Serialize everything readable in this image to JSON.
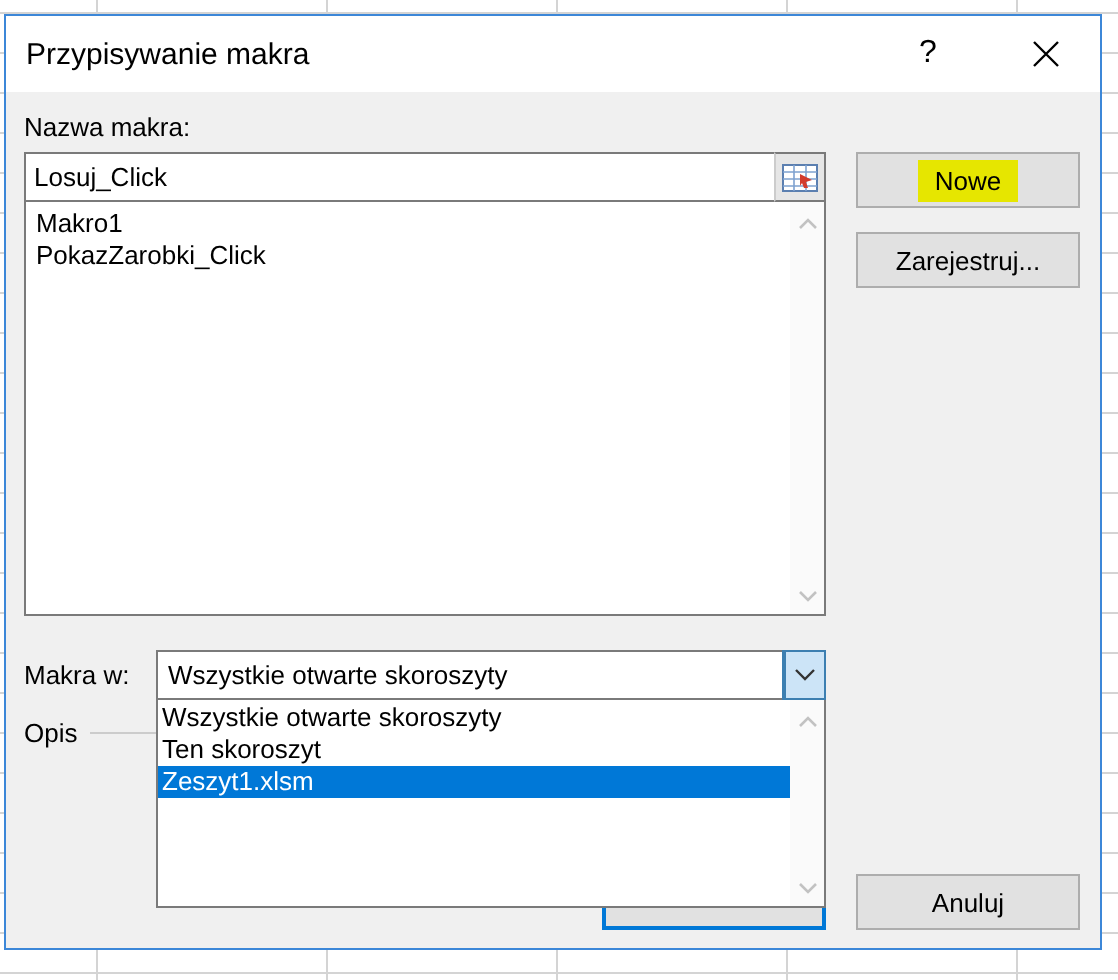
{
  "window": {
    "title": "Przypisywanie makra",
    "help": "?"
  },
  "macro_name": {
    "label": "Nazwa makra:",
    "value": "Losuj_Click"
  },
  "macros": [
    {
      "name": "Makro1",
      "selected": false
    },
    {
      "name": "PokazZarobki_Click",
      "selected": false
    }
  ],
  "macros_in": {
    "label": "Makra w:",
    "value": "Wszystkie otwarte skoroszyty",
    "expanded": true,
    "options": [
      {
        "label": "Wszystkie otwarte skoroszyty",
        "highlighted": false
      },
      {
        "label": "Ten skoroszyt",
        "highlighted": false
      },
      {
        "label": "Zeszyt1.xlsm",
        "highlighted": true
      }
    ]
  },
  "description": {
    "label": "Opis"
  },
  "buttons": [
    {
      "label": "Nowe",
      "highlighted": true
    },
    {
      "label": "Zarejestruj...",
      "highlighted": false
    }
  ],
  "cancel": {
    "label": "Anuluj"
  }
}
